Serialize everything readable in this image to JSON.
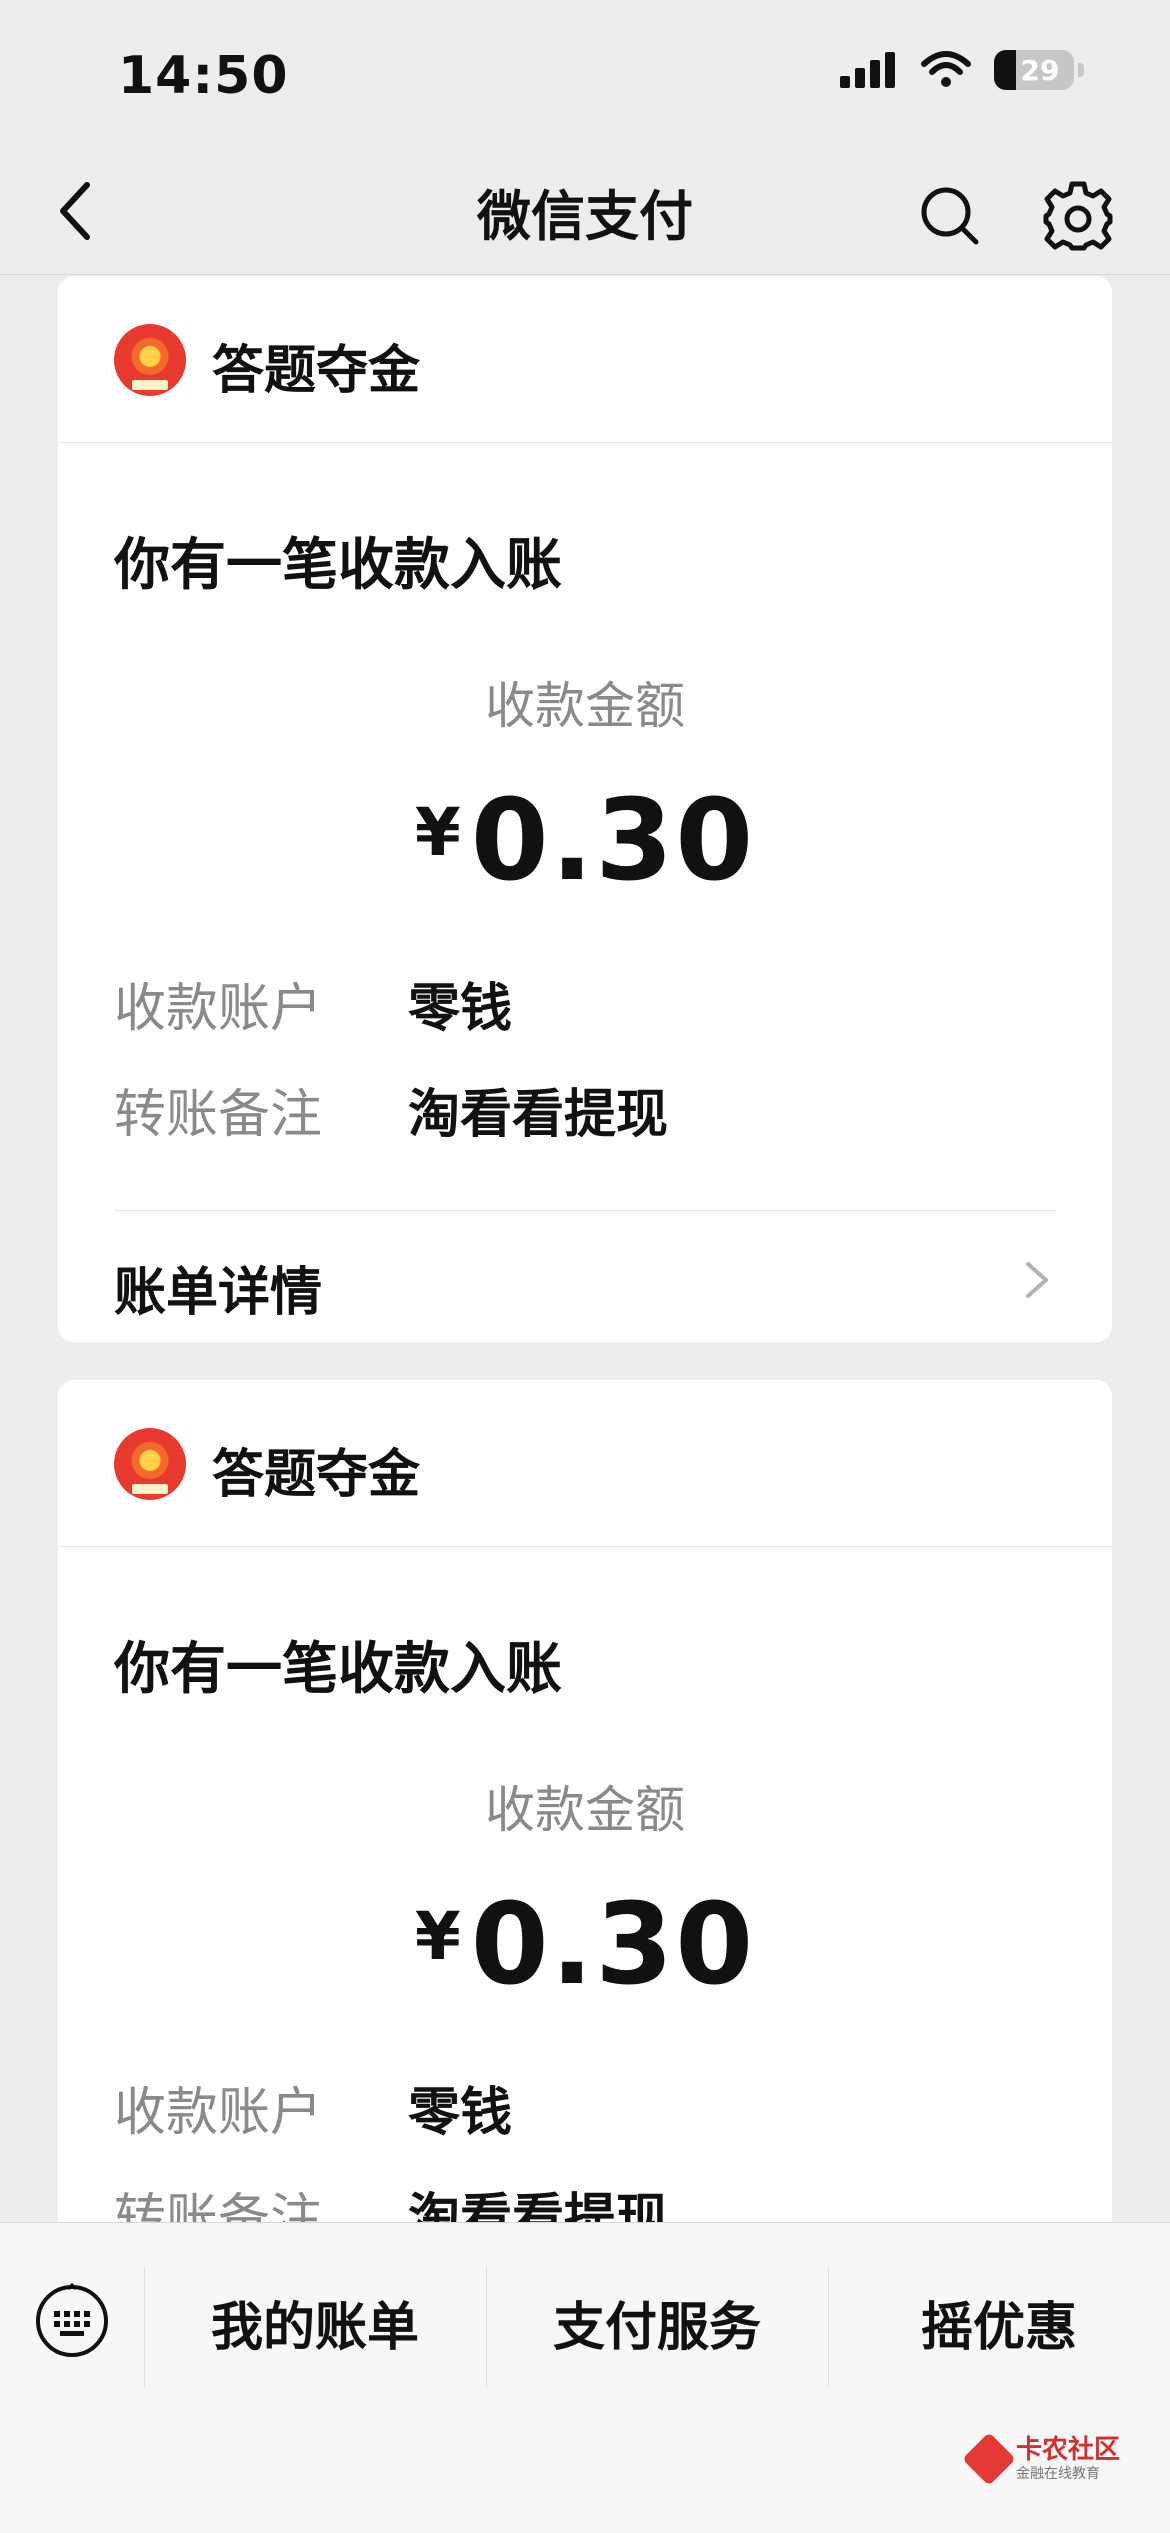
{
  "status_bar": {
    "time": "14:50",
    "battery": "29"
  },
  "nav": {
    "title": "微信支付"
  },
  "cards": [
    {
      "mp_name": "答题夺金",
      "title": "你有一笔收款入账",
      "amount_label": "收款金额",
      "currency": "¥",
      "amount": "0.30",
      "account_key": "收款账户",
      "account_value": "零钱",
      "note_key": "转账备注",
      "note_value": "淘看看提现",
      "detail_label": "账单详情"
    },
    {
      "mp_name": "答题夺金",
      "title": "你有一笔收款入账",
      "amount_label": "收款金额",
      "currency": "¥",
      "amount": "0.30",
      "account_key": "收款账户",
      "account_value": "零钱",
      "note_key": "转账备注",
      "note_value": "淘看看提现"
    }
  ],
  "bottom_menu": {
    "items": [
      "我的账单",
      "支付服务",
      "摇优惠"
    ]
  },
  "watermark": {
    "title": "卡农社区",
    "subtitle": "金融在线教育"
  },
  "colors": {
    "background": "#ededed",
    "card": "#ffffff",
    "secondary_text": "#8a8a8a",
    "accent_red": "#e8392f"
  },
  "icons": [
    "back-arrow-icon",
    "search-icon",
    "gear-icon",
    "chevron-right-icon",
    "keyboard-icon",
    "signal-icon",
    "wifi-icon",
    "battery-icon"
  ]
}
